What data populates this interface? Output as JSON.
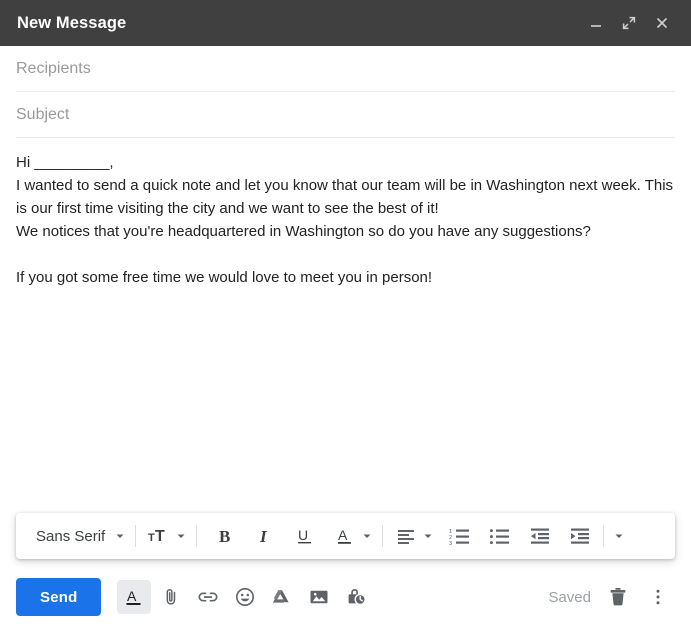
{
  "window": {
    "title": "New Message",
    "controls": [
      {
        "name": "minimize",
        "label": "Minimize",
        "icon": "minimize-icon"
      },
      {
        "name": "expand",
        "label": "Full screen",
        "icon": "expand-icon"
      },
      {
        "name": "close",
        "label": "Save & close",
        "icon": "close-icon"
      }
    ]
  },
  "fields": {
    "recipients": {
      "placeholder": "Recipients",
      "value": ""
    },
    "subject": {
      "placeholder": "Subject",
      "value": ""
    }
  },
  "body": {
    "lines": [
      "Hi _________,",
      "I wanted to send a quick note and let you know that our team will be in Washington next week. This is our first time visiting the city and we want to see the best of it!",
      "We notices that you're headquartered in Washington so do you have any suggestions?",
      "",
      "If you got some free time we would love to meet you in person!"
    ]
  },
  "format_toolbar": {
    "font": {
      "label": "Sans Serif",
      "icon": "chevron-down-icon"
    },
    "text_size": {
      "label": "Font size",
      "icon": "text-size-icon"
    },
    "bold": {
      "label": "B",
      "icon": "bold-icon"
    },
    "italic": {
      "label": "I",
      "icon": "italic-icon"
    },
    "underline": {
      "label": "U",
      "icon": "underline-icon"
    },
    "text_color": {
      "label": "Text color",
      "icon": "text-color-icon"
    },
    "align": {
      "label": "Align",
      "icon": "align-left-icon"
    },
    "numbered_list": {
      "label": "Numbered list",
      "icon": "numbered-list-icon"
    },
    "bulleted_list": {
      "label": "Bulleted list",
      "icon": "bulleted-list-icon"
    },
    "indent_less": {
      "label": "Indent less",
      "icon": "indent-decrease-icon"
    },
    "indent_more": {
      "label": "Indent more",
      "icon": "indent-increase-icon"
    },
    "more": {
      "label": "More formatting options",
      "icon": "chevron-down-icon"
    }
  },
  "action_bar": {
    "send_label": "Send",
    "icons": [
      {
        "name": "formatting-options",
        "label": "Formatting options",
        "icon": "text-format-icon",
        "active": true
      },
      {
        "name": "attach-files",
        "label": "Attach files",
        "icon": "paperclip-icon",
        "active": false
      },
      {
        "name": "insert-link",
        "label": "Insert link",
        "icon": "link-icon",
        "active": false
      },
      {
        "name": "insert-emoji",
        "label": "Insert emoji",
        "icon": "emoji-icon",
        "active": false
      },
      {
        "name": "insert-drive-file",
        "label": "Insert files using Drive",
        "icon": "google-drive-icon",
        "active": false
      },
      {
        "name": "insert-photo",
        "label": "Insert photo",
        "icon": "image-icon",
        "active": false
      },
      {
        "name": "confidential-mode",
        "label": "Toggle confidential mode",
        "icon": "lock-clock-icon",
        "active": false
      }
    ],
    "status": "Saved",
    "discard_label": "Discard draft",
    "more_label": "More options"
  },
  "colors": {
    "titlebar_bg": "#404040",
    "send_blue": "#1a73e8",
    "icon_gray": "#5f6368",
    "placeholder_gray": "#9a9a9a",
    "divider": "#ececec",
    "active_bg": "#e8eaed"
  }
}
